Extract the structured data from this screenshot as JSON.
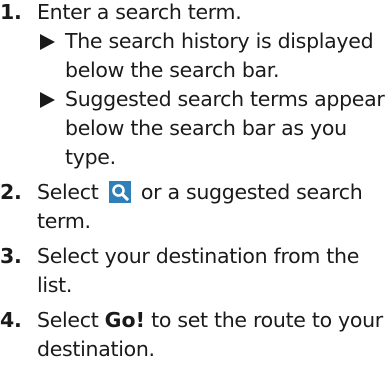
{
  "steps": [
    {
      "number": "1.",
      "text": "Enter a search term.",
      "subpoints": [
        "The search history is displayed below the search bar.",
        "Suggested search terms appear below the search bar as you type."
      ]
    },
    {
      "number": "2.",
      "text_before_icon": "Select",
      "text_after_icon": "or a suggested search term."
    },
    {
      "number": "3.",
      "text": "Select your destination from the list."
    },
    {
      "number": "4.",
      "text_before_button": "Select",
      "button_label": "Go!",
      "text_after_button": "to set the route to your destination."
    }
  ],
  "icons": {
    "search_icon": "search-icon",
    "sub_marker": "triangle-right-icon"
  },
  "colors": {
    "text": "#1a1a1a",
    "icon_background": "#2f7fb8",
    "icon_glyph": "#ffffff"
  }
}
